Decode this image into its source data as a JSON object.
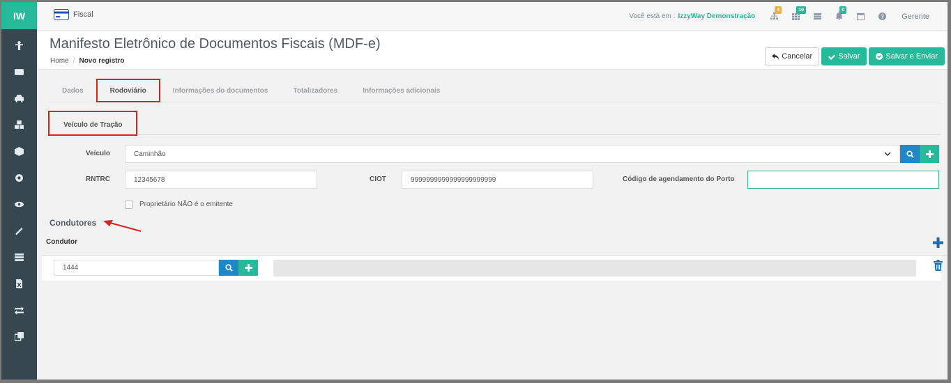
{
  "app": {
    "logo": "IW",
    "module": "Fiscal"
  },
  "topbar": {
    "location_label": "Você está em :",
    "company": "IzzyWay Demonstração",
    "badges": {
      "sitemap": "4",
      "grid": "10",
      "bell": "0"
    },
    "badge_colors": {
      "sitemap": "#f0ad4e",
      "grid": "#26b99a",
      "bell": "#26b99a"
    },
    "user": "Gerente"
  },
  "header": {
    "title": "Manifesto Eletrônico de Documentos Fiscais (MDF-e)",
    "breadcrumb": [
      "Home",
      "Novo registro"
    ],
    "cancel_label": "Cancelar",
    "save_label": "Salvar",
    "save_send_label": "Salvar e Enviar"
  },
  "tabs": [
    "Dados",
    "Rodoviário",
    "Informações do documentos",
    "Totalizadores",
    "Informações adicionais"
  ],
  "active_tab": "Rodoviário",
  "subtab": "Veículo de Tração",
  "form": {
    "veiculo_label": "Veículo",
    "veiculo_value": "Caminhão",
    "rntrc_label": "RNTRC",
    "rntrc_value": "12345678",
    "ciot_label": "CIOT",
    "ciot_value": "9999999999999999999999",
    "porto_label": "Código de agendamento do Porto",
    "porto_value": "",
    "owner_checkbox_label": "Proprietário NÃO é o emitente",
    "owner_checkbox_checked": false
  },
  "condutores": {
    "section_title": "Condutores",
    "column_header": "Condutor",
    "rows": [
      {
        "code": "1444"
      }
    ]
  },
  "colors": {
    "accent": "#26b99a",
    "blue": "#1e88c8",
    "sidebar": "#37474f",
    "highlight": "#e02020"
  }
}
